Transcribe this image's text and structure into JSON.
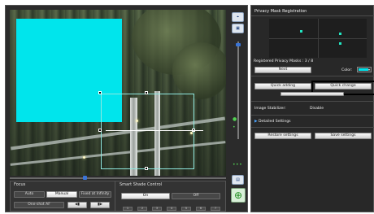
{
  "toolbar": {
    "zoom_icon": "zoom-icon",
    "camera_icon": "camera-icon"
  },
  "focus": {
    "title": "Focus",
    "auto_label": "Auto",
    "manual_label": "Manual",
    "fixed_label": "Fixed at Infinity",
    "one_shot_label": "One-shot AF"
  },
  "smart_shade": {
    "title": "Smart Shade Control",
    "on_label": "On",
    "off_label": "Off",
    "levels": [
      "1",
      "2",
      "3",
      "4",
      "5",
      "6",
      "7"
    ]
  },
  "privacy": {
    "title": "Privacy Mask Registration",
    "registered_label": "Registered Privacy Masks : 3 / 8",
    "next_label": "Next",
    "color_label": "Color:",
    "mask_color": "#00e5ec",
    "quick_adding_label": "Quick adding",
    "quick_change_label": "Quick change"
  },
  "image_stabilizer": {
    "label": "Image Stabilizer:",
    "value": "Disable"
  },
  "detailed_settings_label": "Detailed Settings",
  "restore_label": "Restore settings",
  "save_label": "Save settings",
  "colors": {
    "mask": "#00e5ec",
    "accent": "#3a74d6",
    "indicator": "#52d152"
  }
}
